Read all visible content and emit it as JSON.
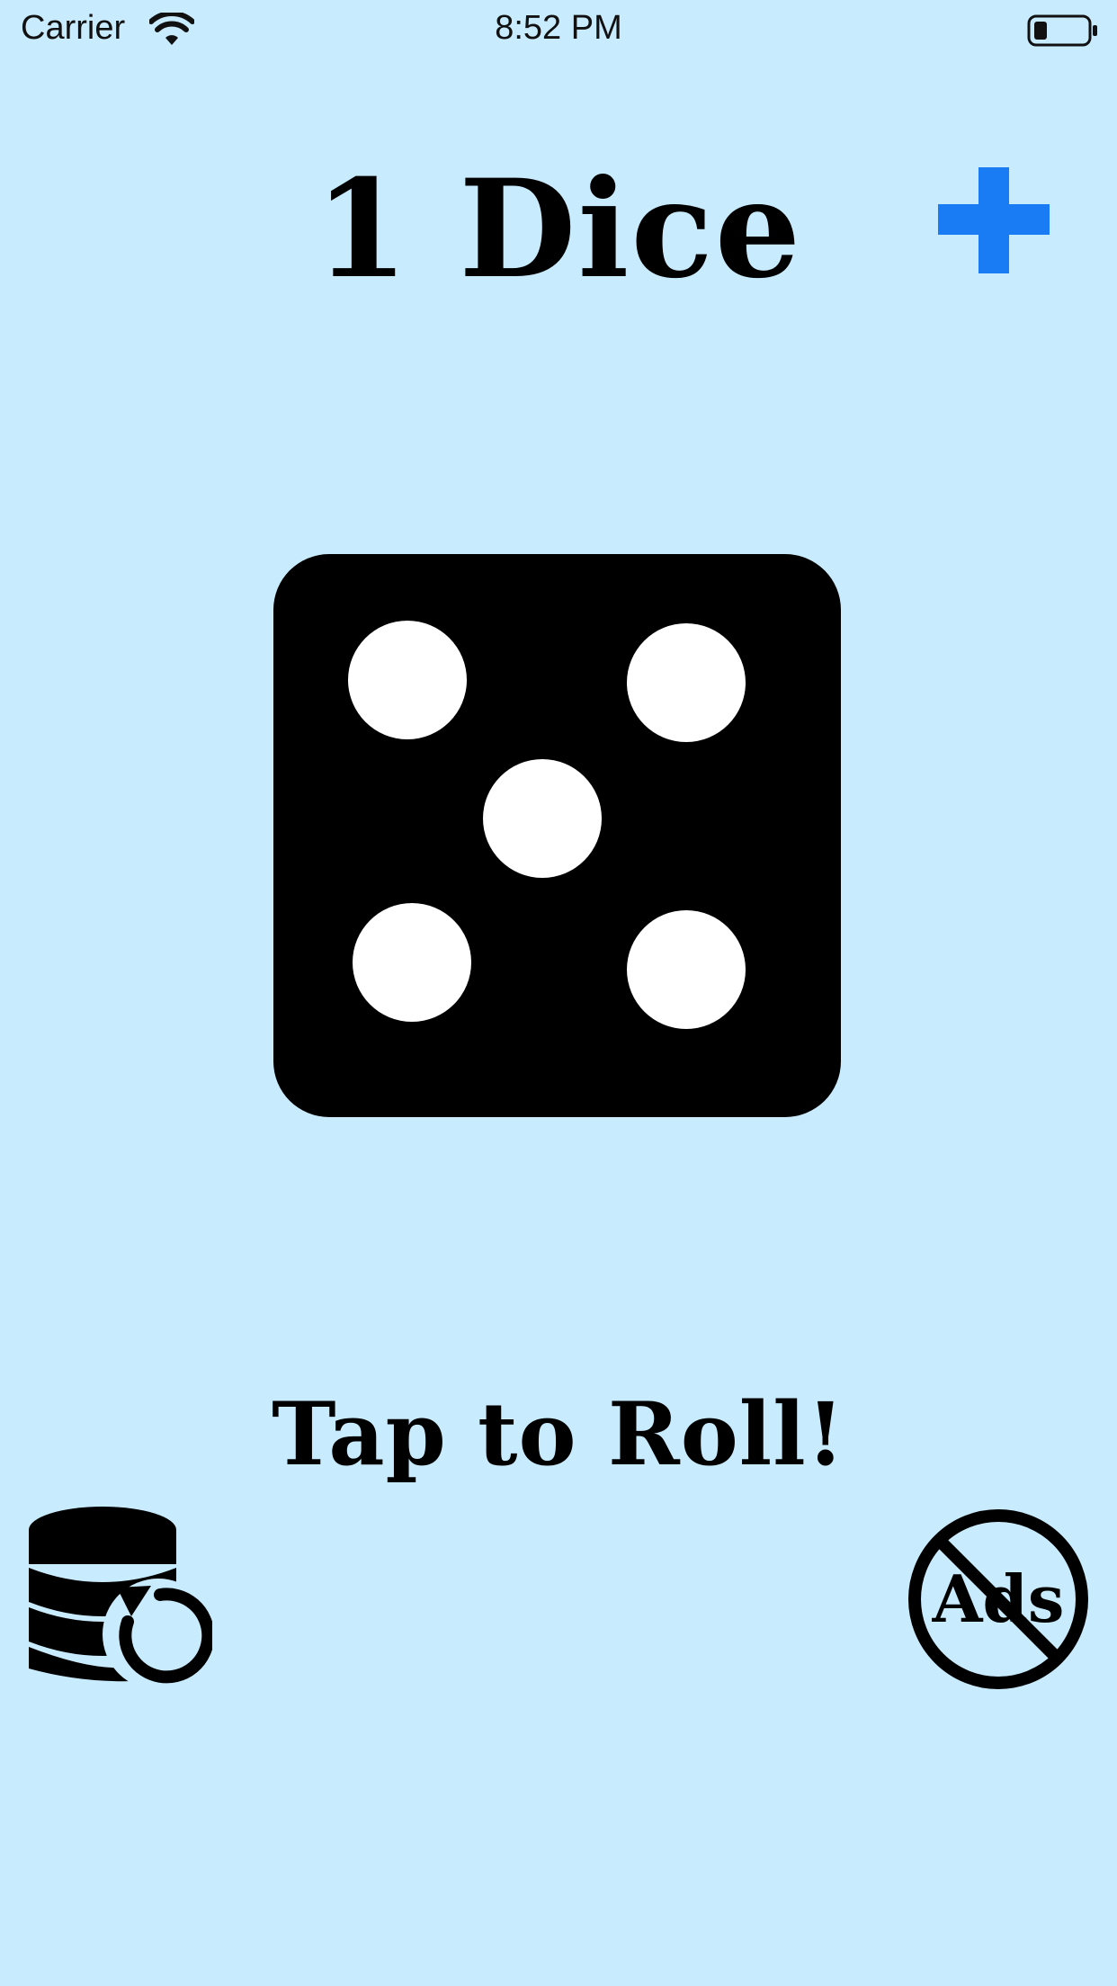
{
  "status_bar": {
    "carrier": "Carrier",
    "time": "8:52 PM",
    "icons": [
      "wifi-icon",
      "battery-icon"
    ]
  },
  "header": {
    "title": "1 Dice",
    "add_icon": "plus-icon",
    "accent_color": "#1a7cf5"
  },
  "die": {
    "value": 5,
    "color": "#000000",
    "pip_color": "#ffffff"
  },
  "prompt": {
    "label": "Tap to Roll!"
  },
  "bottom_bar": {
    "reset_icon": "database-reset-icon",
    "no_ads_icon": "no-ads-icon",
    "no_ads_text": "Ads"
  },
  "colors": {
    "background": "#c9ebfe"
  }
}
